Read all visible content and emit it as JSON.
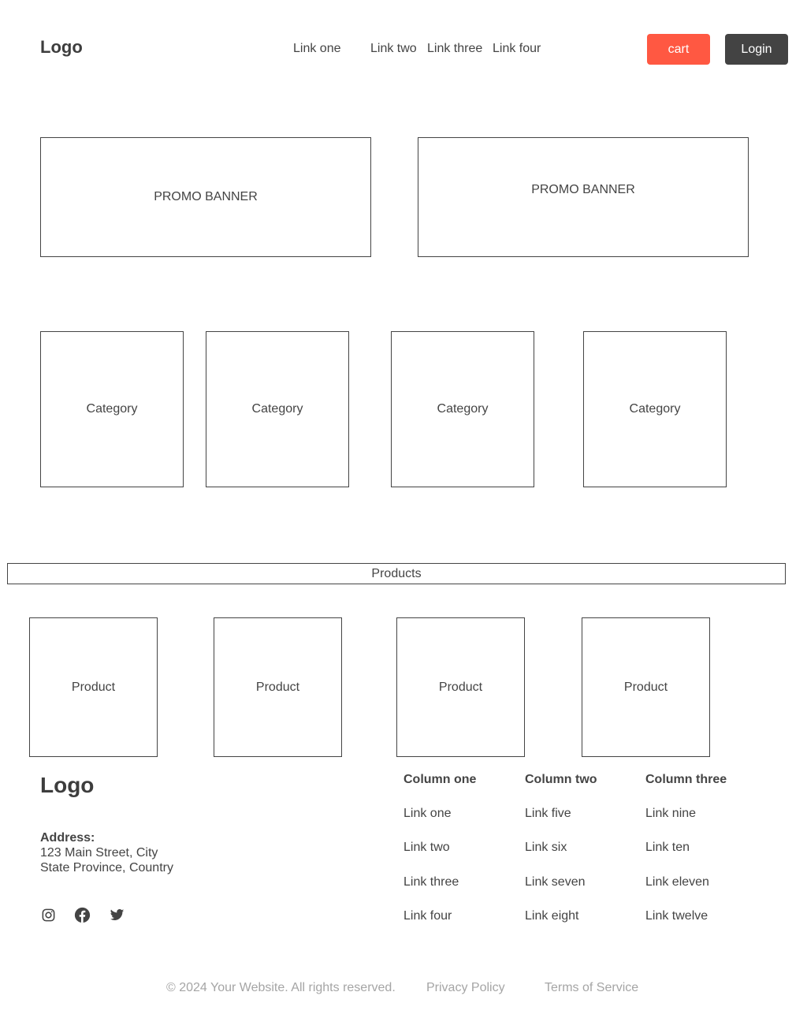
{
  "header": {
    "logo": "Logo",
    "nav": [
      "Link one",
      "Link two",
      "Link three",
      "Link four"
    ],
    "cart_label": "cart",
    "login_label": "Login",
    "cart_color": "#ff5842",
    "login_color": "#434343"
  },
  "promos": [
    "PROMO BANNER",
    "PROMO BANNER"
  ],
  "categories": [
    "Category",
    "Category",
    "Category",
    "Category"
  ],
  "products_title": "Products",
  "products": [
    "Product",
    "Product",
    "Product",
    "Product"
  ],
  "footer": {
    "logo": "Logo",
    "address_label": "Address:",
    "address_line1": "123 Main Street, City",
    "address_line2": "State Province, Country",
    "social_icons": [
      "instagram-icon",
      "facebook-icon",
      "twitter-icon"
    ],
    "columns": [
      {
        "title": "Column one",
        "links": [
          "Link one",
          "Link two",
          "Link three",
          "Link four"
        ]
      },
      {
        "title": "Column two",
        "links": [
          "Link five",
          "Link six",
          "Link seven",
          "Link eight"
        ]
      },
      {
        "title": "Column three",
        "links": [
          "Link nine",
          "Link ten",
          "Link eleven",
          "Link twelve"
        ]
      }
    ],
    "copyright": "© 2024 Your Website. All rights reserved.",
    "privacy": "Privacy Policy",
    "terms": "Terms of Service"
  }
}
